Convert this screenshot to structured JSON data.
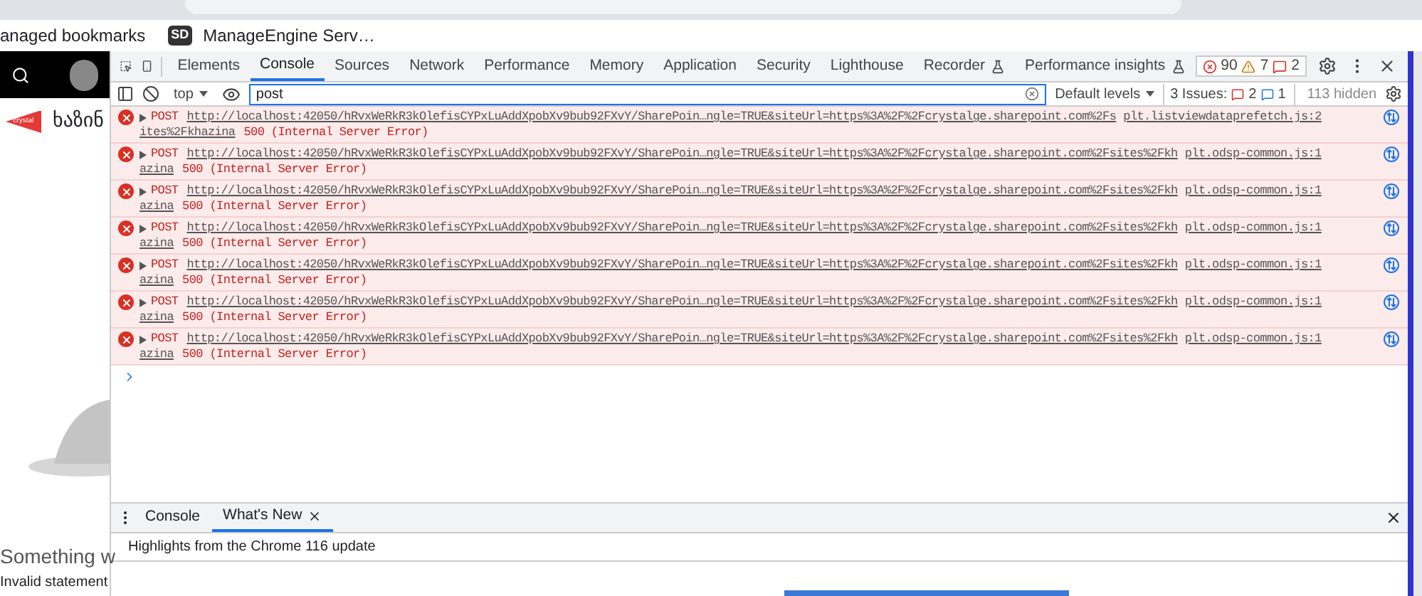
{
  "browser": {
    "bookmarks": [
      {
        "kind": "text",
        "label": "anaged bookmarks"
      },
      {
        "kind": "badge",
        "badge": "SD",
        "label": "ManageEngine Serv…"
      }
    ]
  },
  "page": {
    "logo_text": "crystal",
    "heading": "ხაზინ",
    "error_title": "Something w",
    "error_detail": "Invalid statement"
  },
  "devtools": {
    "tabs": [
      {
        "label": "Elements",
        "selected": false,
        "experimental": false
      },
      {
        "label": "Console",
        "selected": true,
        "experimental": false
      },
      {
        "label": "Sources",
        "selected": false,
        "experimental": false
      },
      {
        "label": "Network",
        "selected": false,
        "experimental": false
      },
      {
        "label": "Performance",
        "selected": false,
        "experimental": false
      },
      {
        "label": "Memory",
        "selected": false,
        "experimental": false
      },
      {
        "label": "Application",
        "selected": false,
        "experimental": false
      },
      {
        "label": "Security",
        "selected": false,
        "experimental": false
      },
      {
        "label": "Lighthouse",
        "selected": false,
        "experimental": false
      },
      {
        "label": "Recorder",
        "selected": false,
        "experimental": true
      },
      {
        "label": "Performance insights",
        "selected": false,
        "experimental": true
      }
    ],
    "counters": {
      "errors": "90",
      "warnings": "7",
      "issues": "2"
    },
    "filter": {
      "context": "top",
      "value": "post",
      "levels": "Default levels",
      "issues_label": "3 Issues:",
      "issues_errors": "2",
      "issues_info": "1",
      "hidden": "113 hidden"
    },
    "messages": [
      {
        "method": "POST",
        "url_line1": "http://localhost:42050/hRvxWeRkR3kOlefisCYPxLuAddXpobXv9bub92FXvY/SharePoin…ngle=TRUE&siteUrl=https%3A%2F%2Fcrystalge.sharepoint.com%2Fs",
        "url_line2": "ites%2Fkhazina",
        "status": "500 (Internal Server Error)",
        "source": "plt.listviewdataprefetch.js:2"
      },
      {
        "method": "POST",
        "url_line1": "http://localhost:42050/hRvxWeRkR3kOlefisCYPxLuAddXpobXv9bub92FXvY/SharePoin…ngle=TRUE&siteUrl=https%3A%2F%2Fcrystalge.sharepoint.com%2Fsites%2Fkh",
        "url_line2": "azina",
        "status": "500 (Internal Server Error)",
        "source": "plt.odsp-common.js:1"
      },
      {
        "method": "POST",
        "url_line1": "http://localhost:42050/hRvxWeRkR3kOlefisCYPxLuAddXpobXv9bub92FXvY/SharePoin…ngle=TRUE&siteUrl=https%3A%2F%2Fcrystalge.sharepoint.com%2Fsites%2Fkh",
        "url_line2": "azina",
        "status": "500 (Internal Server Error)",
        "source": "plt.odsp-common.js:1"
      },
      {
        "method": "POST",
        "url_line1": "http://localhost:42050/hRvxWeRkR3kOlefisCYPxLuAddXpobXv9bub92FXvY/SharePoin…ngle=TRUE&siteUrl=https%3A%2F%2Fcrystalge.sharepoint.com%2Fsites%2Fkh",
        "url_line2": "azina",
        "status": "500 (Internal Server Error)",
        "source": "plt.odsp-common.js:1"
      },
      {
        "method": "POST",
        "url_line1": "http://localhost:42050/hRvxWeRkR3kOlefisCYPxLuAddXpobXv9bub92FXvY/SharePoin…ngle=TRUE&siteUrl=https%3A%2F%2Fcrystalge.sharepoint.com%2Fsites%2Fkh",
        "url_line2": "azina",
        "status": "500 (Internal Server Error)",
        "source": "plt.odsp-common.js:1"
      },
      {
        "method": "POST",
        "url_line1": "http://localhost:42050/hRvxWeRkR3kOlefisCYPxLuAddXpobXv9bub92FXvY/SharePoin…ngle=TRUE&siteUrl=https%3A%2F%2Fcrystalge.sharepoint.com%2Fsites%2Fkh",
        "url_line2": "azina",
        "status": "500 (Internal Server Error)",
        "source": "plt.odsp-common.js:1"
      },
      {
        "method": "POST",
        "url_line1": "http://localhost:42050/hRvxWeRkR3kOlefisCYPxLuAddXpobXv9bub92FXvY/SharePoin…ngle=TRUE&siteUrl=https%3A%2F%2Fcrystalge.sharepoint.com%2Fsites%2Fkh",
        "url_line2": "azina",
        "status": "500 (Internal Server Error)",
        "source": "plt.odsp-common.js:1"
      }
    ],
    "drawer": {
      "tabs": [
        {
          "label": "Console",
          "selected": false,
          "closable": false
        },
        {
          "label": "What's New",
          "selected": true,
          "closable": true
        }
      ],
      "headline": "Highlights from the Chrome 116 update"
    }
  }
}
